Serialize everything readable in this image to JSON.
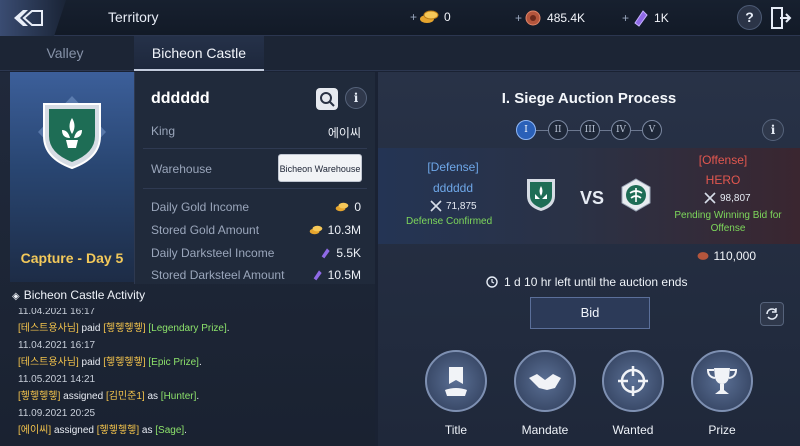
{
  "topbar": {
    "title": "Territory",
    "resources": [
      {
        "icon": "gold-coin-icon",
        "value": "0"
      },
      {
        "icon": "copper-coin-icon",
        "value": "485.4K"
      },
      {
        "icon": "purple-crystal-icon",
        "value": "1K"
      }
    ],
    "help_icon": "?"
  },
  "tabs": [
    {
      "label": "Valley"
    },
    {
      "label": "Bicheon Castle"
    }
  ],
  "left": {
    "capture_text": "Capture - Day 5",
    "guild_name": "dddddd",
    "info_icon": "i",
    "rows": [
      {
        "label": "King",
        "value": "에이씨"
      },
      {
        "label": "Warehouse",
        "button": "Bicheon Warehouse"
      },
      {
        "label": "Daily Gold Income",
        "value": "0"
      },
      {
        "label": "Stored Gold Amount",
        "value": "10.3M"
      },
      {
        "label": "Daily Darksteel Income",
        "value": "5.5K"
      },
      {
        "label": "Stored Darksteel Amount",
        "value": "10.5M"
      }
    ],
    "activity_title": "Bicheon Castle Activity",
    "activity": [
      {
        "date": "11.04.2021 16:17",
        "actor": "[테스트용사님]",
        "verb": " paid ",
        "target": "[헿헿헿헿]",
        "item": "[Legendary Prize]",
        "end": "."
      },
      {
        "date": "11.04.2021 16:17",
        "actor": "[테스트용사님]",
        "verb": " paid ",
        "target": "[헿헿헿헿]",
        "item": "[Epic Prize]",
        "end": "."
      },
      {
        "date": "11.05.2021 14:21",
        "actor": "[헿헿헿헿]",
        "verb": " assigned ",
        "target": "[김민준1]",
        "mid": " as ",
        "item": "[Hunter]",
        "end": "."
      },
      {
        "date": "11.09.2021 20:25",
        "actor": "[에이씨]",
        "verb": " assigned ",
        "target": "[헿헿헿헿]",
        "mid": " as ",
        "item": "[Sage]",
        "end": "."
      }
    ]
  },
  "right": {
    "title": "I. Siege Auction Process",
    "steps": [
      "I",
      "II",
      "III",
      "IV",
      "V"
    ],
    "info_icon": "i",
    "defense": {
      "label": "[Defense]",
      "name": "dddddd",
      "power": "71,875",
      "status": "Defense Confirmed"
    },
    "vs": "VS",
    "offense": {
      "label": "[Offense]",
      "name": "HERO",
      "power": "98,807",
      "status": "Pending Winning Bid for Offense"
    },
    "bid_amount": "110,000",
    "time_left": "1 d 10 hr left until the auction ends",
    "bid_label": "Bid",
    "actions": [
      {
        "label": "Title",
        "icon": "title-banner-icon"
      },
      {
        "label": "Mandate",
        "icon": "handshake-icon"
      },
      {
        "label": "Wanted",
        "icon": "crosshair-icon"
      },
      {
        "label": "Prize",
        "icon": "trophy-icon"
      }
    ]
  },
  "colors": {
    "gold": "#f3c95a",
    "defense_blue": "#6ea7e8",
    "offense_red": "#e2574f",
    "confirm_green": "#7ed85b"
  }
}
